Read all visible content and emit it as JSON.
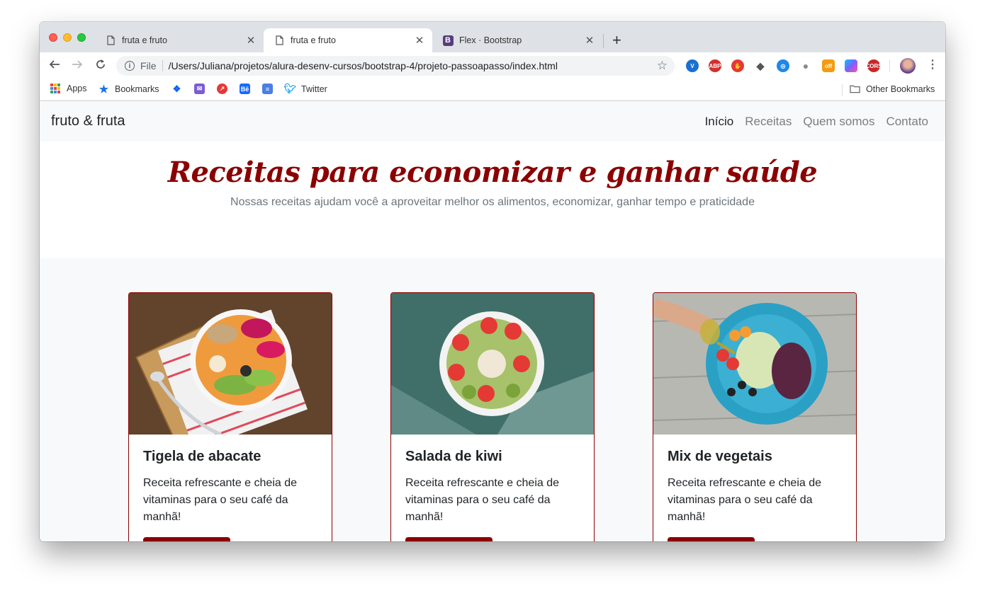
{
  "browser": {
    "tabs": [
      {
        "title": "fruta e fruto",
        "active": false,
        "close": "✕"
      },
      {
        "title": "fruta e fruto",
        "active": true,
        "close": "✕"
      },
      {
        "title": "Flex · Bootstrap",
        "active": false,
        "close": "✕",
        "favicon_letter": "B"
      }
    ],
    "new_tab": "+",
    "address": {
      "scheme": "File",
      "url": "/Users/Juliana/projetos/alura-desenv-cursos/bootstrap-4/projeto-passoapasso/index.html"
    },
    "extensions": [
      {
        "name": "vimium-icon",
        "label": "V",
        "color": "#1a6fd1"
      },
      {
        "name": "adblock-icon",
        "label": "ABP",
        "color": "#d32f2f"
      },
      {
        "name": "stop-hand-icon",
        "label": "✋",
        "color": "#e53935"
      },
      {
        "name": "pocket-icon",
        "label": "◆",
        "color": "#555555"
      },
      {
        "name": "extension-blue-icon",
        "label": "◎",
        "color": "#1e88e5"
      },
      {
        "name": "speech-bubble-icon",
        "label": "●",
        "color": "#8a8a8a"
      },
      {
        "name": "off-badge-icon",
        "label": "off",
        "color": "#f39c12"
      },
      {
        "name": "gradient-square-icon",
        "label": "",
        "color": "#7b61ff"
      },
      {
        "name": "cors-icon",
        "label": "CORS",
        "color": "#c62828"
      }
    ],
    "bookmarks": [
      {
        "label": "Apps",
        "icon": "apps-grid-icon"
      },
      {
        "label": "Bookmarks",
        "icon": "star-icon"
      },
      {
        "label": "",
        "icon": "dropbox-icon"
      },
      {
        "label": "",
        "icon": "mail-icon"
      },
      {
        "label": "",
        "icon": "chart-icon"
      },
      {
        "label": "",
        "icon": "behance-icon"
      },
      {
        "label": "",
        "icon": "docs-icon"
      },
      {
        "label": "Twitter",
        "icon": "twitter-icon"
      }
    ],
    "other_bookmarks": "Other Bookmarks"
  },
  "site": {
    "brand": "fruto & fruta",
    "nav": [
      {
        "label": "Início",
        "current": true
      },
      {
        "label": "Receitas",
        "current": false
      },
      {
        "label": "Quem somos",
        "current": false
      },
      {
        "label": "Contato",
        "current": false
      }
    ],
    "hero": {
      "title": "Receitas para economizar e ganhar saúde",
      "subtitle": "Nossas receitas ajudam você a aproveitar melhor os alimentos, economizar, ganhar tempo e praticidade"
    },
    "cards": [
      {
        "title": "Tigela de abacate",
        "text": "Receita refrescante e cheia de vitaminas para o seu café da manhã!",
        "image": "avocado-bowl-photo"
      },
      {
        "title": "Salada de kiwi",
        "text": "Receita refrescante e cheia de vitaminas para o seu café da manhã!",
        "image": "kiwi-bowl-photo"
      },
      {
        "title": "Mix de vegetais",
        "text": "Receita refrescante e cheia de vitaminas para o seu café da manhã!",
        "image": "vegetable-plate-photo"
      }
    ]
  },
  "colors": {
    "accent": "#8b0000",
    "muted": "#6c757d",
    "navbar_bg": "#f8f9fa"
  }
}
